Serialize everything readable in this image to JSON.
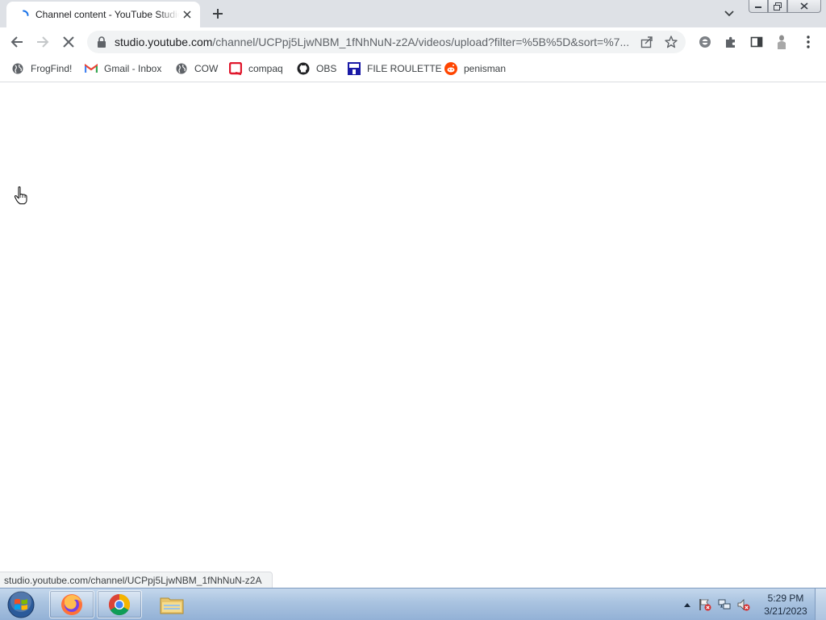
{
  "tab": {
    "title": "Channel content - YouTube Studio",
    "loading": true
  },
  "toolbar": {
    "url_host": "studio.youtube.com",
    "url_path": "/channel/UCPpj5LjwNBM_1fNhNuN-z2A/videos/upload?filter=%5B%5D&sort=%7..."
  },
  "bookmarks": [
    {
      "label": "FrogFind!",
      "icon": "globe-icon"
    },
    {
      "label": "Gmail - Inbox",
      "icon": "gmail-icon"
    },
    {
      "label": "COW",
      "icon": "globe-icon"
    },
    {
      "label": "compaq",
      "icon": "compaq-icon"
    },
    {
      "label": "OBS",
      "icon": "github-icon"
    },
    {
      "label": "FILE ROULETTE",
      "icon": "file-roulette-icon"
    },
    {
      "label": "penisman",
      "icon": "reddit-icon"
    }
  ],
  "status_bar": {
    "link": "studio.youtube.com/channel/UCPpj5LjwNBM_1fNhNuN-z2A"
  },
  "taskbar": {
    "time": "5:29 PM",
    "date": "3/21/2023",
    "apps": [
      "firefox-icon",
      "chrome-icon",
      "file-explorer-icon"
    ]
  },
  "colors": {
    "tabstrip": "#dee1e6",
    "omnibox": "#f1f3f4",
    "taskbar": "#a9c3e0"
  }
}
